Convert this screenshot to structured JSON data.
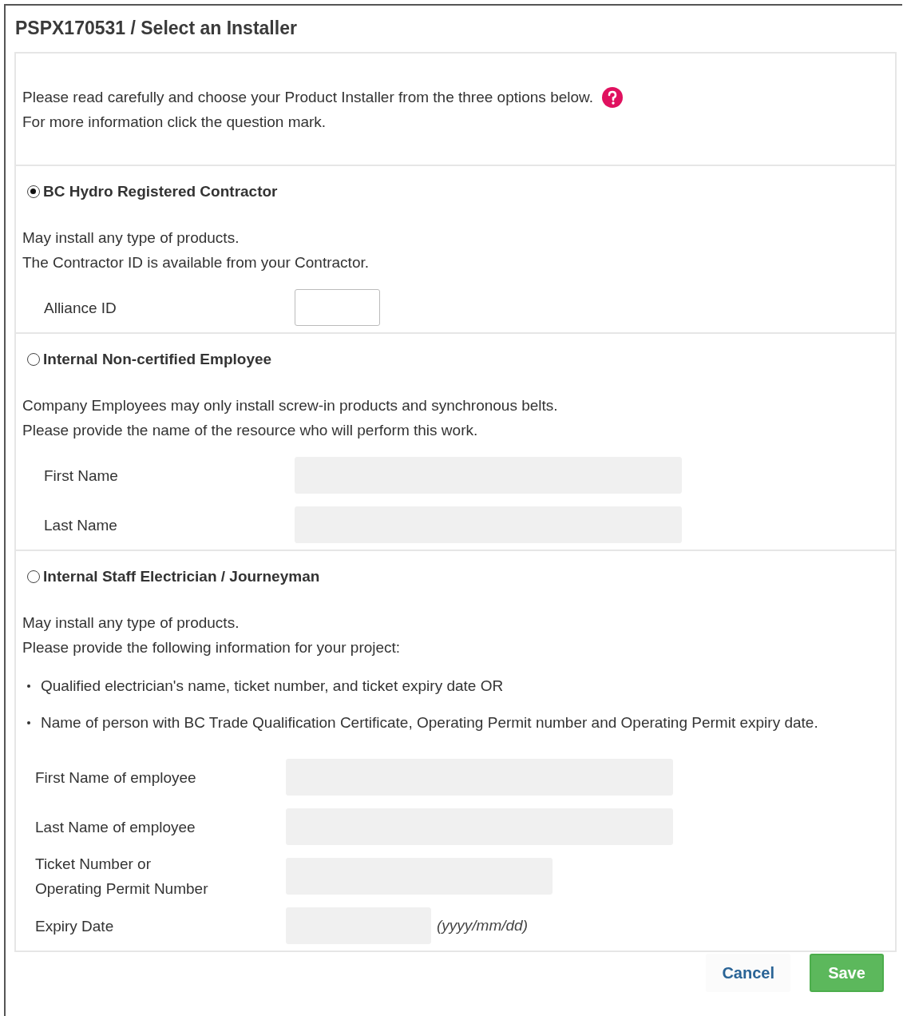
{
  "title": "PSPX170531 / Select an Installer",
  "intro": [
    "Please read carefully and choose your Product Installer from the three options below.",
    "For more information click the question mark."
  ],
  "options": [
    {
      "label": "BC Hydro Registered Contractor",
      "selected": true,
      "description": [
        "May install any type of products.",
        "The Contractor ID is available from your Contractor."
      ],
      "fields": [
        {
          "label": "Alliance ID",
          "kind": "short"
        }
      ]
    },
    {
      "label": "Internal Non-certified Employee",
      "selected": false,
      "description": [
        "Company Employees may only install screw-in products and synchronous belts.",
        "Please provide the name of the resource who will perform this work."
      ],
      "fields": [
        {
          "label": "First Name",
          "kind": "wide"
        },
        {
          "label": "Last Name",
          "kind": "wide"
        }
      ]
    },
    {
      "label": "Internal Staff Electrician / Journeyman",
      "selected": false,
      "description": [
        "May install any type of products.",
        "Please provide the following information for your project:"
      ],
      "bullets": [
        "Qualified electrician's name, ticket number, and ticket expiry date OR",
        "Name of person with BC Trade Qualification Certificate, Operating Permit number and Operating Permit expiry date."
      ],
      "fields": [
        {
          "label": "First Name of employee",
          "kind": "wide"
        },
        {
          "label": "Last Name of employee",
          "kind": "wide"
        },
        {
          "label": "Ticket Number or\nOperating Permit Number",
          "kind": "medium"
        },
        {
          "label": "Expiry Date",
          "kind": "date",
          "hint": "(yyyy/mm/dd)"
        }
      ]
    }
  ],
  "buttons": [
    {
      "label": "Cancel",
      "kind": "link"
    },
    {
      "label": "Save",
      "kind": "primary"
    }
  ]
}
